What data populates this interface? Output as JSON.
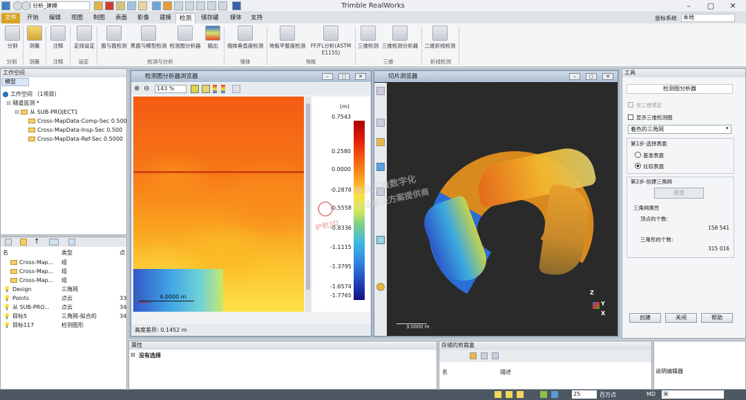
{
  "app": {
    "title": "Trimble RealWorks",
    "project_combo": "分析_建模"
  },
  "menu": [
    "文件",
    "开始",
    "编辑",
    "视图",
    "制图",
    "表面",
    "影像",
    "建模",
    "检测",
    "储存罐",
    "媒体",
    "支持"
  ],
  "coord_system": {
    "label": "坐标系统",
    "value": "本地"
  },
  "ribbon": {
    "buttons": [
      "分割",
      "测量",
      "注释",
      "定线设定",
      "面与面检测",
      "表面与模型检测",
      "检测图分析器",
      "输出",
      "墙体垂直度检测",
      "地板平整度检测",
      "FF/FL分析(ASTM E1155)",
      "三维检测",
      "三维检测分析器",
      "二维折线检测"
    ],
    "groups": [
      "分割",
      "测量",
      "注释",
      "设定",
      "检测与分析",
      "墙体",
      "地板",
      "三维",
      "折线检测"
    ]
  },
  "workspace": {
    "title": "工作空间",
    "tab": "模型",
    "root": "工作空间 （1项目）",
    "project": "隧道监测 *",
    "sub": "从 SUB-PROJECT1",
    "items": [
      "Cross-MapData-Comp-Sec 0.500",
      "Cross-MapData-Insp-Sec 0.500",
      "Cross-MapData-Ref-Sec 0.5000"
    ]
  },
  "list": {
    "headers": [
      "名",
      "类型",
      "点"
    ],
    "rows": [
      {
        "name": "Cross-Map...",
        "type": "组",
        "points": ""
      },
      {
        "name": "Cross-Map...",
        "type": "组",
        "points": ""
      },
      {
        "name": "Cross-Map...",
        "type": "组",
        "points": ""
      },
      {
        "name": "Design",
        "type": "三角网",
        "points": ""
      },
      {
        "name": "Points",
        "type": "点云",
        "points": "33"
      },
      {
        "name": "从 SUB-PRO...",
        "type": "点云",
        "points": "34"
      },
      {
        "name": "目标5",
        "type": "三角网-拟合的",
        "points": "34"
      },
      {
        "name": "目标117",
        "type": "检测图形",
        "points": ""
      }
    ]
  },
  "inspector": {
    "title": "检测图分析器浏览器",
    "zoom": "143 %",
    "scale_label": "4.0000 m",
    "status": "高度差异:  0.1452 m",
    "colorbar_unit": "(m)",
    "colorbar_ticks": [
      "0.7543",
      "0.2580",
      "0.0000",
      "-0.2878",
      "-0.5558",
      "-0.8336",
      "-1.1115",
      "-1.3795",
      "-1.6574",
      "-1.7765"
    ]
  },
  "slice": {
    "title": "切片浏览器",
    "scale_label": "3.0000 m",
    "axes": [
      "Z",
      "Y",
      "X"
    ]
  },
  "tools": {
    "title": "工具",
    "subtitle": "检测图分析器",
    "chk_2d": "在二维锁定",
    "chk_3d": "显示三维检测图",
    "combo": "着色的三角网",
    "step1": "第1步-选择表面",
    "radio_base": "基准表面",
    "radio_compare": "比较表面",
    "step2": "第2步-创建三角网",
    "preview": "预览",
    "mesh_props": "三角网属性",
    "vertex_label": "顶点的个数:",
    "vertex_value": "158 541",
    "tri_label": "三角形的个数:",
    "tri_value": "315 016",
    "btn_create": "创建",
    "btn_close": "关闭",
    "btn_help": "帮助"
  },
  "properties": {
    "title": "属性",
    "empty": "没有选择"
  },
  "clip_store": {
    "title": "存储的剪裁盒",
    "headers": [
      "名",
      "描述"
    ]
  },
  "desc_editor": {
    "title": "说明编辑器"
  },
  "statusbar": {
    "count": "25",
    "unit": "百万点",
    "md": "MD",
    "unit2": "米"
  },
  "watermark": {
    "line1": "专业三维数字化",
    "line2": "行业解决方案提供商",
    "brand": "护航3D"
  }
}
